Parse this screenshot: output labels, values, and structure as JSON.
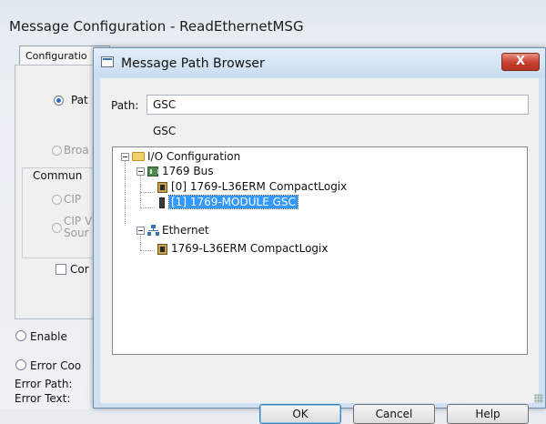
{
  "background_window": {
    "title": "Message Configuration - ReadEthernetMSG",
    "tab_label": "Configuratio",
    "radio_path_label": "Pat",
    "radio_broadcast_label": "Broa",
    "group_label": "Commun",
    "radio_cip_label": "CIP",
    "radio_cipv_label_line1": "CIP V",
    "radio_cipv_label_line2": "Sour",
    "checkbox_label": "Cor",
    "enable_label": "Enable",
    "error_code_label": "Error Coo",
    "error_path_label": "Error Path:",
    "error_text_label": "Error Text:"
  },
  "dialog": {
    "title": "Message Path Browser",
    "close_glyph": "X",
    "path_label": "Path:",
    "path_value": "GSC",
    "path_echo": "GSC",
    "tree": {
      "root": "I/O Configuration",
      "bus": "1769 Bus",
      "bus_items": [
        "[0] 1769-L36ERM CompactLogix",
        "[1] 1769-MODULE GSC"
      ],
      "selected_item": "[1] 1769-MODULE GSC",
      "ethernet": "Ethernet",
      "ethernet_items": [
        "1769-L36ERM CompactLogix"
      ]
    },
    "buttons": {
      "ok": "OK",
      "cancel": "Cancel",
      "help": "Help"
    }
  },
  "colors": {
    "selection": "#3399ff",
    "close_button": "#c5412e",
    "dialog_frame": "#cfe0f2"
  }
}
